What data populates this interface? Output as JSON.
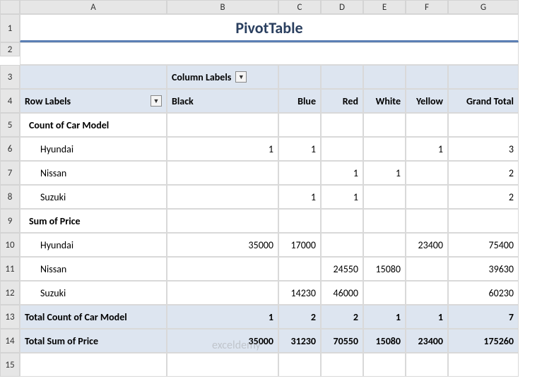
{
  "cols": [
    "A",
    "B",
    "C",
    "D",
    "E",
    "F",
    "G"
  ],
  "rows": [
    "1",
    "2",
    "3",
    "4",
    "5",
    "6",
    "7",
    "8",
    "9",
    "10",
    "11",
    "12",
    "13",
    "14",
    "15"
  ],
  "title": "PivotTable",
  "columnLabelsHdr": "Column Labels",
  "rowLabelsHdr": "Row Labels",
  "colorHeaders": [
    "Black",
    "Blue",
    "Red",
    "White",
    "Yellow",
    "Grand Total"
  ],
  "sec1": "Count of Car Model",
  "sec2": "Sum of Price",
  "tot1": "Total Count of Car Model",
  "tot2": "Total Sum of Price",
  "brands": [
    "Hyundai",
    "Nissan",
    "Suzuki"
  ],
  "count": {
    "Hyundai": {
      "Black": "1",
      "Blue": "1",
      "Red": "",
      "White": "",
      "Yellow": "1",
      "GT": "3"
    },
    "Nissan": {
      "Black": "",
      "Blue": "",
      "Red": "1",
      "White": "1",
      "Yellow": "",
      "GT": "2"
    },
    "Suzuki": {
      "Black": "",
      "Blue": "1",
      "Red": "1",
      "White": "",
      "Yellow": "",
      "GT": "2"
    }
  },
  "price": {
    "Hyundai": {
      "Black": "35000",
      "Blue": "17000",
      "Red": "",
      "White": "",
      "Yellow": "23400",
      "GT": "75400"
    },
    "Nissan": {
      "Black": "",
      "Blue": "",
      "Red": "24550",
      "White": "15080",
      "Yellow": "",
      "GT": "39630"
    },
    "Suzuki": {
      "Black": "",
      "Blue": "14230",
      "Red": "46000",
      "White": "",
      "Yellow": "",
      "GT": "60230"
    }
  },
  "totCount": {
    "Black": "1",
    "Blue": "2",
    "Red": "2",
    "White": "1",
    "Yellow": "1",
    "GT": "7"
  },
  "totPrice": {
    "Black": "35000",
    "Blue": "31230",
    "Red": "70550",
    "White": "15080",
    "Yellow": "23400",
    "GT": "175260"
  },
  "watermark": "exceldemy"
}
